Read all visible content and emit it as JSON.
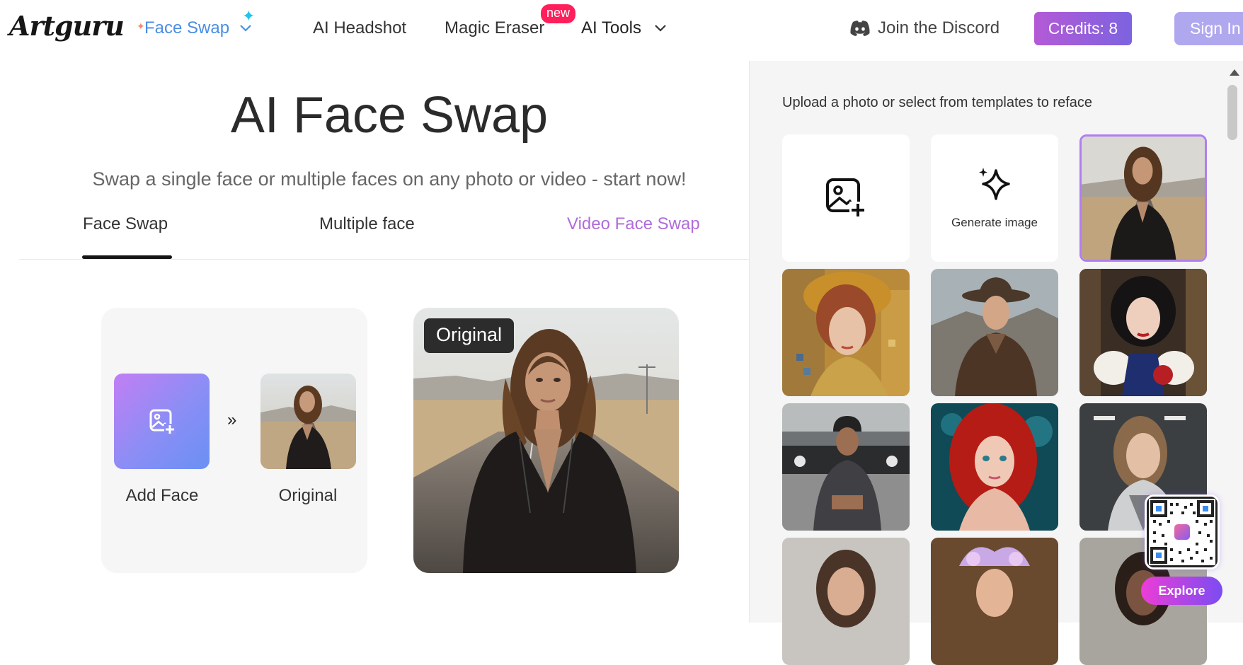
{
  "header": {
    "logo": "Artguru",
    "nav": {
      "face_swap": "Face Swap",
      "ai_headshot": "AI Headshot",
      "magic_eraser": "Magic Eraser",
      "new_badge": "new",
      "ai_tools": "AI Tools"
    },
    "discord": "Join the Discord",
    "credits": "Credits: 8",
    "sign_in": "Sign In"
  },
  "hero": {
    "title": "AI Face Swap",
    "subtitle": "Swap a single face or multiple faces on any photo or video - start now!"
  },
  "tabs": [
    {
      "label": "Face Swap",
      "active": true
    },
    {
      "label": "Multiple face",
      "active": false
    },
    {
      "label": "Video Face Swap",
      "active": false
    }
  ],
  "workspace": {
    "add_face_label": "Add Face",
    "original_label": "Original",
    "preview_badge": "Original"
  },
  "panel": {
    "title": "Upload a photo or select from templates to reface",
    "generate_label": "Generate image",
    "templates": [
      {
        "name": "woman-leather-jacket-road",
        "selected": true
      },
      {
        "name": "klimt-style-portrait"
      },
      {
        "name": "cowboy-man"
      },
      {
        "name": "snow-white-apple"
      },
      {
        "name": "man-with-car"
      },
      {
        "name": "red-haired-mermaid"
      },
      {
        "name": "futuristic-woman"
      },
      {
        "name": "portrait-woman-dark-hair"
      },
      {
        "name": "fairy-crown-woman"
      },
      {
        "name": "woman-portrait"
      }
    ]
  },
  "widget": {
    "explore": "Explore"
  },
  "colors": {
    "accent_blue": "#4a8ee6",
    "video_tab": "#b06cd9",
    "new_badge": "#ff1f5a",
    "credits_start": "#b45ad6",
    "credits_end": "#7d63e0",
    "selected_border": "#b07ef0"
  }
}
